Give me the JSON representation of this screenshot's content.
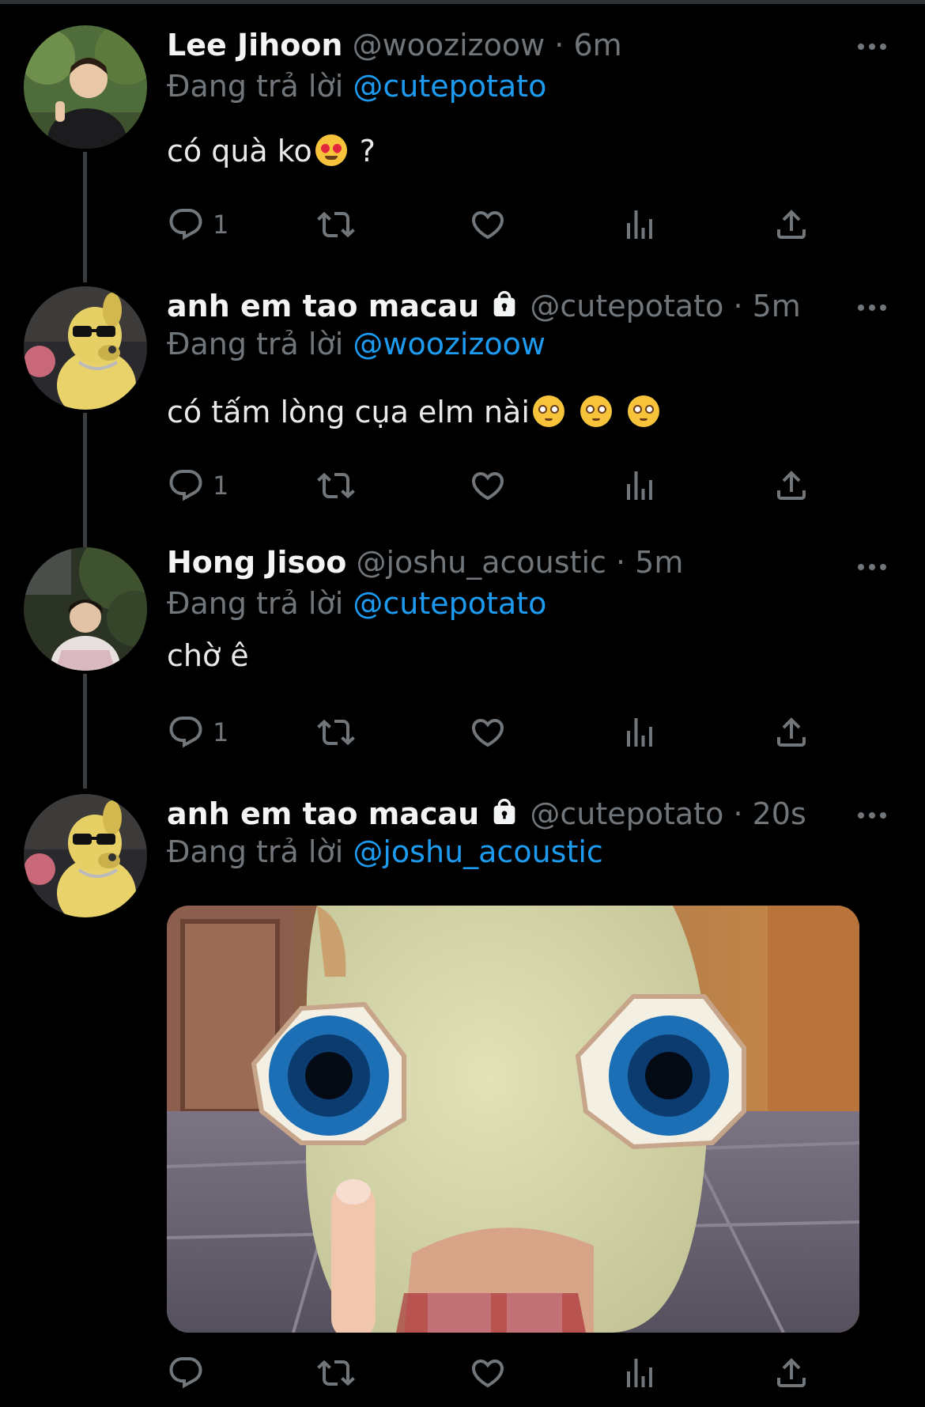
{
  "reply_prefix": "Đang trả lời",
  "tweets": [
    {
      "name": "Lee Jihoon",
      "handle": "@woozizoow",
      "time": "· 6m",
      "reply_to": "@cutepotato",
      "text": "có quà ko",
      "text_after": " ?",
      "reply_count": "1"
    },
    {
      "name": "anh em tao macau",
      "handle": "@cutepotato",
      "time": "· 5m",
      "reply_to": "@woozizoow",
      "text": "có tấm lòng cụa elm nài",
      "reply_count": "1"
    },
    {
      "name": "Hong Jisoo",
      "handle": "@joshu_acoustic",
      "time": "· 5m",
      "reply_to": "@cutepotato",
      "text": "chờ ê",
      "reply_count": "1"
    },
    {
      "name": "anh em tao macau",
      "handle": "@cutepotato",
      "time": "· 20s",
      "reply_to": "@joshu_acoustic",
      "reply_count": ""
    }
  ],
  "icons": {
    "reply": "reply-icon",
    "retweet": "retweet-icon",
    "like": "heart-icon",
    "analytics": "analytics-icon",
    "share": "share-icon",
    "more": "more-icon",
    "protected": "lock-icon"
  },
  "colors": {
    "background": "#000000",
    "link": "#1d9bf0",
    "secondary_text": "#71767b",
    "primary_text": "#e7e9ea"
  }
}
